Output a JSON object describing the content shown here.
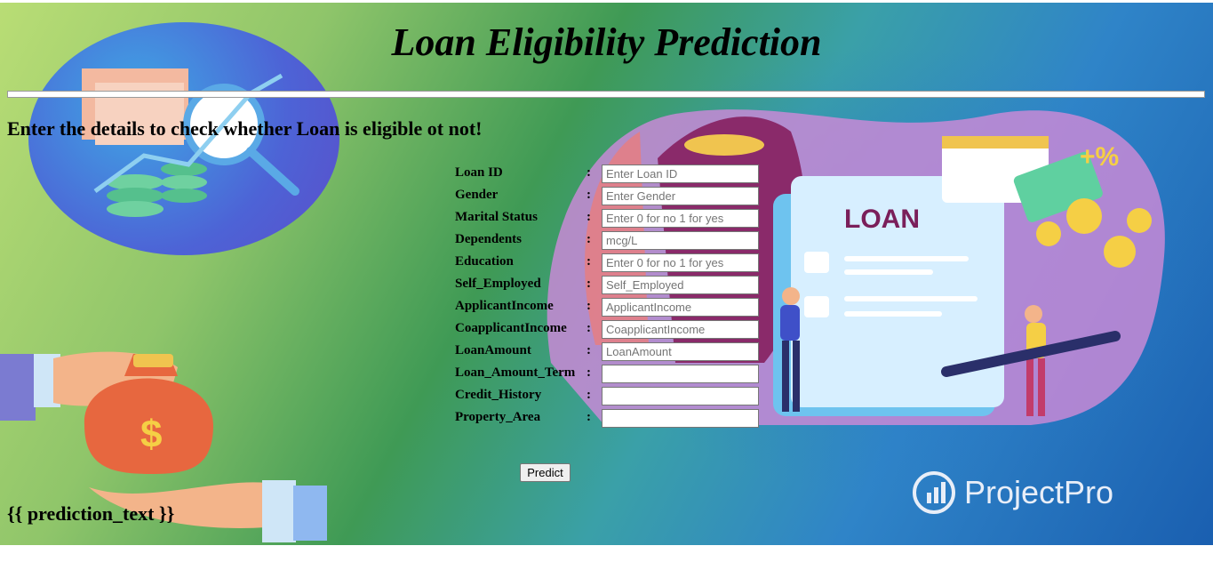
{
  "page": {
    "title": "Loan Eligibility Prediction",
    "subtitle": "Enter the details to check whether Loan is eligible ot not!",
    "prediction_text": "{{ prediction_text }}",
    "brand": "ProjectPro"
  },
  "form": {
    "fields": [
      {
        "label": "Loan ID",
        "placeholder": "Enter Loan ID"
      },
      {
        "label": "Gender",
        "placeholder": "Enter Gender"
      },
      {
        "label": "Marital Status",
        "placeholder": "Enter 0 for no 1 for yes"
      },
      {
        "label": "Dependents",
        "placeholder": "mcg/L"
      },
      {
        "label": "Education",
        "placeholder": "Enter 0 for no 1 for yes"
      },
      {
        "label": "Self_Employed",
        "placeholder": "Self_Employed"
      },
      {
        "label": "ApplicantIncome",
        "placeholder": "ApplicantIncome"
      },
      {
        "label": "CoapplicantIncome",
        "placeholder": "CoapplicantIncome"
      },
      {
        "label": "LoanAmount",
        "placeholder": "LoanAmount"
      },
      {
        "label": "Loan_Amount_Term",
        "placeholder": ""
      },
      {
        "label": "Credit_History",
        "placeholder": ""
      },
      {
        "label": "Property_Area",
        "placeholder": ""
      }
    ],
    "colon": ":",
    "submit_label": "Predict"
  },
  "illustration": {
    "loan_sign": "LOAN",
    "percent_badge": "+%",
    "dollar_symbol": "$"
  },
  "colors": {
    "background_start": "#b9dd75",
    "background_end": "#1a5fb0",
    "text": "#000000"
  }
}
